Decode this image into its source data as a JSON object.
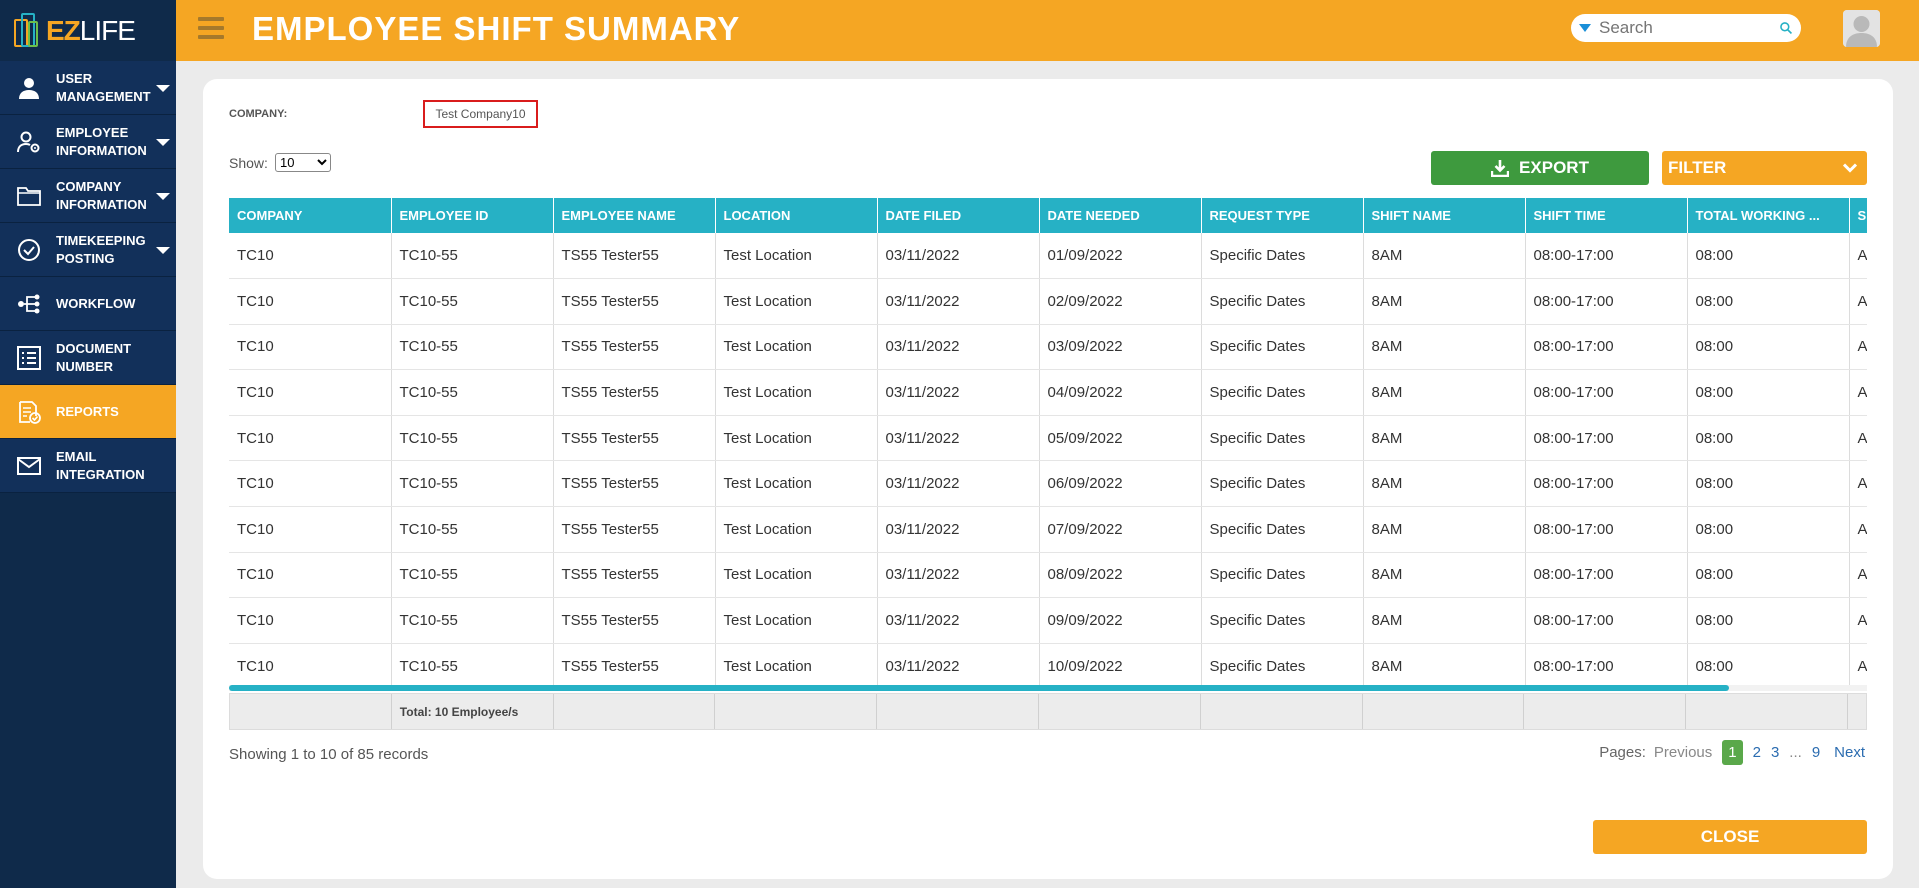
{
  "app": {
    "logo_ez": "EZ",
    "logo_life": "LIFE"
  },
  "header": {
    "title": "EMPLOYEE SHIFT SUMMARY",
    "search_placeholder": "Search"
  },
  "sidebar": {
    "items": [
      {
        "label": "USER MANAGEMENT",
        "icon": "user-icon",
        "expandable": true
      },
      {
        "label": "EMPLOYEE INFORMATION",
        "icon": "user-gear-icon",
        "expandable": true
      },
      {
        "label": "COMPANY INFORMATION",
        "icon": "folder-icon",
        "expandable": true
      },
      {
        "label": "TIMEKEEPING POSTING",
        "icon": "check-circle-icon",
        "expandable": true
      },
      {
        "label": "WORKFLOW",
        "icon": "workflow-icon",
        "expandable": false
      },
      {
        "label": "DOCUMENT NUMBER",
        "icon": "list-icon",
        "expandable": false
      },
      {
        "label": "REPORTS",
        "icon": "report-icon",
        "expandable": false,
        "active": true
      },
      {
        "label": "EMAIL INTEGRATION",
        "icon": "mail-icon",
        "expandable": false
      }
    ]
  },
  "filters": {
    "company_label": "COMPANY:",
    "company_value": "Test Company10",
    "show_label": "Show:",
    "show_value": "10",
    "export_label": "EXPORT",
    "filter_label": "FILTER"
  },
  "table": {
    "columns": [
      "COMPANY",
      "EMPLOYEE ID",
      "EMPLOYEE NAME",
      "LOCATION",
      "DATE FILED",
      "DATE NEEDED",
      "REQUEST TYPE",
      "SHIFT NAME",
      "SHIFT TIME",
      "TOTAL WORKING ...",
      "S"
    ],
    "rows": [
      [
        "TC10",
        "TC10-55",
        "TS55 Tester55",
        "Test Location",
        "03/11/2022",
        "01/09/2022",
        "Specific Dates",
        "8AM",
        "08:00-17:00",
        "08:00",
        "A"
      ],
      [
        "TC10",
        "TC10-55",
        "TS55 Tester55",
        "Test Location",
        "03/11/2022",
        "02/09/2022",
        "Specific Dates",
        "8AM",
        "08:00-17:00",
        "08:00",
        "A"
      ],
      [
        "TC10",
        "TC10-55",
        "TS55 Tester55",
        "Test Location",
        "03/11/2022",
        "03/09/2022",
        "Specific Dates",
        "8AM",
        "08:00-17:00",
        "08:00",
        "A"
      ],
      [
        "TC10",
        "TC10-55",
        "TS55 Tester55",
        "Test Location",
        "03/11/2022",
        "04/09/2022",
        "Specific Dates",
        "8AM",
        "08:00-17:00",
        "08:00",
        "A"
      ],
      [
        "TC10",
        "TC10-55",
        "TS55 Tester55",
        "Test Location",
        "03/11/2022",
        "05/09/2022",
        "Specific Dates",
        "8AM",
        "08:00-17:00",
        "08:00",
        "A"
      ],
      [
        "TC10",
        "TC10-55",
        "TS55 Tester55",
        "Test Location",
        "03/11/2022",
        "06/09/2022",
        "Specific Dates",
        "8AM",
        "08:00-17:00",
        "08:00",
        "A"
      ],
      [
        "TC10",
        "TC10-55",
        "TS55 Tester55",
        "Test Location",
        "03/11/2022",
        "07/09/2022",
        "Specific Dates",
        "8AM",
        "08:00-17:00",
        "08:00",
        "A"
      ],
      [
        "TC10",
        "TC10-55",
        "TS55 Tester55",
        "Test Location",
        "03/11/2022",
        "08/09/2022",
        "Specific Dates",
        "8AM",
        "08:00-17:00",
        "08:00",
        "A"
      ],
      [
        "TC10",
        "TC10-55",
        "TS55 Tester55",
        "Test Location",
        "03/11/2022",
        "09/09/2022",
        "Specific Dates",
        "8AM",
        "08:00-17:00",
        "08:00",
        "A"
      ],
      [
        "TC10",
        "TC10-55",
        "TS55 Tester55",
        "Test Location",
        "03/11/2022",
        "10/09/2022",
        "Specific Dates",
        "8AM",
        "08:00-17:00",
        "08:00",
        "A"
      ]
    ],
    "footer_total": "Total: 10 Employee/s"
  },
  "pagination": {
    "records_text": "Showing 1 to 10 of 85 records",
    "pages_label": "Pages:",
    "previous": "Previous",
    "pages": [
      "1",
      "2",
      "3"
    ],
    "current": "1",
    "ellipsis": "...",
    "last": "9",
    "next": "Next"
  },
  "actions": {
    "close_label": "CLOSE"
  },
  "colors": {
    "accent": "#f5a623",
    "sidebar": "#0f2a4a",
    "table_header": "#26b1c5",
    "export": "#3e9a3e"
  }
}
